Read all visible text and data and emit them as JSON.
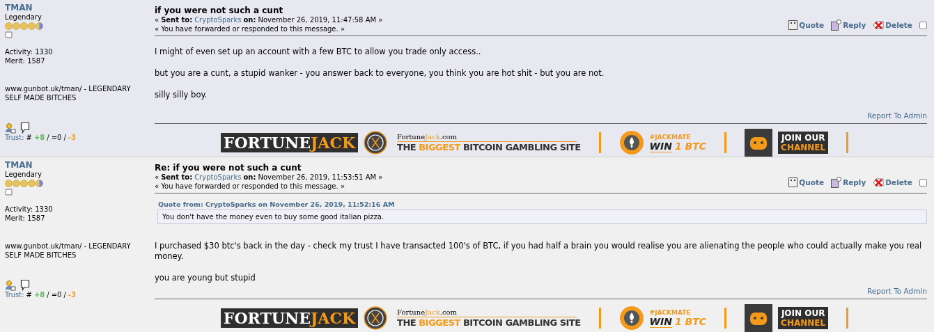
{
  "posts": [
    {
      "author": {
        "name": "TMAN",
        "rank": "Legendary",
        "stars": 4.5,
        "activity": "Activity: 1330",
        "merit": "Merit: 1587",
        "signature": [
          "www.gunbot.uk/tman/ - LEGENDARY",
          "SELF MADE BITCHES"
        ],
        "trust": {
          "label": "Trust:",
          "hash": "#",
          "positive": "+8",
          "sep1": "/",
          "neutral": "=0",
          "sep2": "/",
          "negative": "-3"
        }
      },
      "subject": "if you were not such a cunt",
      "sent_open": "«",
      "sent_label": "Sent to:",
      "recipient": "CryptoSparks",
      "on_label": "on:",
      "date": "November 26, 2019, 11:47:58 AM",
      "sent_close": "»",
      "status": "« You have forwarded or responded to this message. »",
      "actions": [
        "Quote",
        "Reply",
        "Delete"
      ],
      "checked": false,
      "paragraphs": [
        "I might of even set up an account with a few BTC to allow you trade only access..",
        "but you are a cunt, a stupid wanker - you answer back to everyone, you think you are hot shit - but you are not.",
        "silly silly boy."
      ],
      "report": "Report To Admin",
      "banner": {
        "logo_first": "FORTUNE",
        "logo_second": "JACK",
        "domain_first": "Fortune",
        "domain_accent": "Jack",
        "domain_last": ".com",
        "tagline": [
          {
            "text": "THE ",
            "accent": false
          },
          {
            "text": "BIGGEST ",
            "accent": true
          },
          {
            "text": "BITCOIN GAMBLING SITE",
            "accent": false
          }
        ],
        "tag": "#JACKMATE",
        "win": "WIN",
        "win_amount": "1 BTC",
        "join": "JOIN OUR",
        "channel": "CHANNEL"
      }
    },
    {
      "author": {
        "name": "TMAN",
        "rank": "Legendary",
        "stars": 4.5,
        "activity": "Activity: 1330",
        "merit": "Merit: 1587",
        "signature": [
          "www.gunbot.uk/tman/ - LEGENDARY",
          "SELF MADE BITCHES"
        ],
        "trust": {
          "label": "Trust:",
          "hash": "#",
          "positive": "+8",
          "sep1": "/",
          "neutral": "=0",
          "sep2": "/",
          "negative": "-3"
        }
      },
      "subject": "Re: if you were not such a cunt",
      "sent_open": "«",
      "sent_label": "Sent to:",
      "recipient": "CryptoSparks",
      "on_label": "on:",
      "date": "November 26, 2019, 11:53:51 AM",
      "sent_close": "»",
      "status": "« You have forwarded or responded to this message. »",
      "actions": [
        "Quote",
        "Reply",
        "Delete"
      ],
      "checked": false,
      "quote": {
        "header": "Quote from: CryptoSparks on November 26, 2019, 11:52:16 AM",
        "text": "You don't have the money even to buy some good italian pizza."
      },
      "paragraphs": [
        "I purchased $30 btc's back in the day - check my trust I have transacted 100's of BTC, if you had half a brain you would realise you are alienating the people who could actually make you real money.",
        "you are young but stupid"
      ],
      "report": "Report To Admin",
      "banner": {
        "logo_first": "FORTUNE",
        "logo_second": "JACK",
        "domain_first": "Fortune",
        "domain_accent": "Jack",
        "domain_last": ".com",
        "tagline": [
          {
            "text": "THE ",
            "accent": false
          },
          {
            "text": "BIGGEST ",
            "accent": true
          },
          {
            "text": "BITCOIN GAMBLING SITE",
            "accent": false
          }
        ],
        "tag": "#JACKMATE",
        "win": "WIN",
        "win_amount": "1 BTC",
        "join": "JOIN OUR",
        "channel": "CHANNEL"
      }
    }
  ]
}
